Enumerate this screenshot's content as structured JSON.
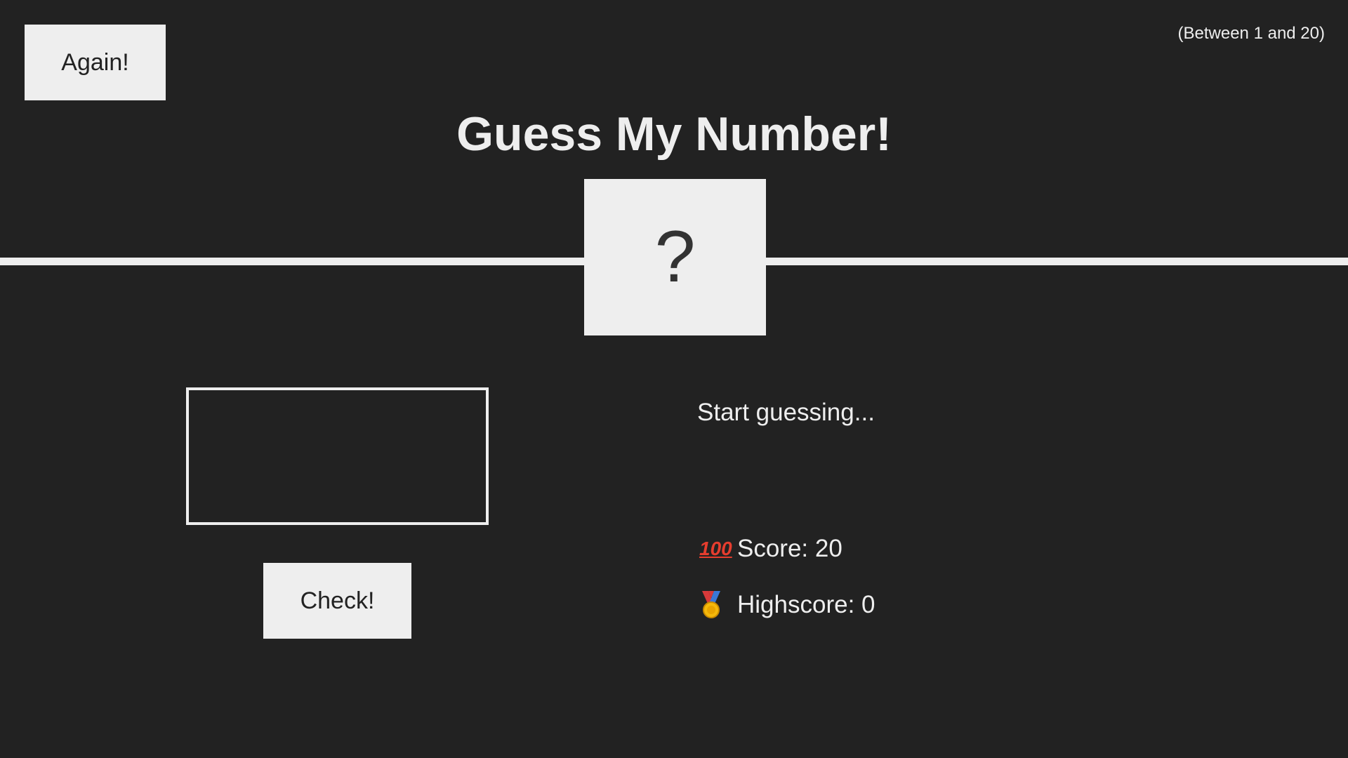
{
  "header": {
    "again_label": "Again!",
    "range_text": "(Between 1 and 20)",
    "title": "Guess My Number!"
  },
  "secret_number": {
    "display": "?"
  },
  "guess": {
    "value": "",
    "placeholder": ""
  },
  "check_label": "Check!",
  "message": "Start guessing...",
  "stats": {
    "score_icon": "hundred-points-icon",
    "score_label": "Score:",
    "score_value": "20",
    "highscore_icon": "medal-icon",
    "highscore_label": "Highscore:",
    "highscore_value": "0"
  },
  "colors": {
    "background": "#222222",
    "foreground": "#eeeeee",
    "score_icon": "#e63d2e",
    "medal": "#f5b90b"
  }
}
